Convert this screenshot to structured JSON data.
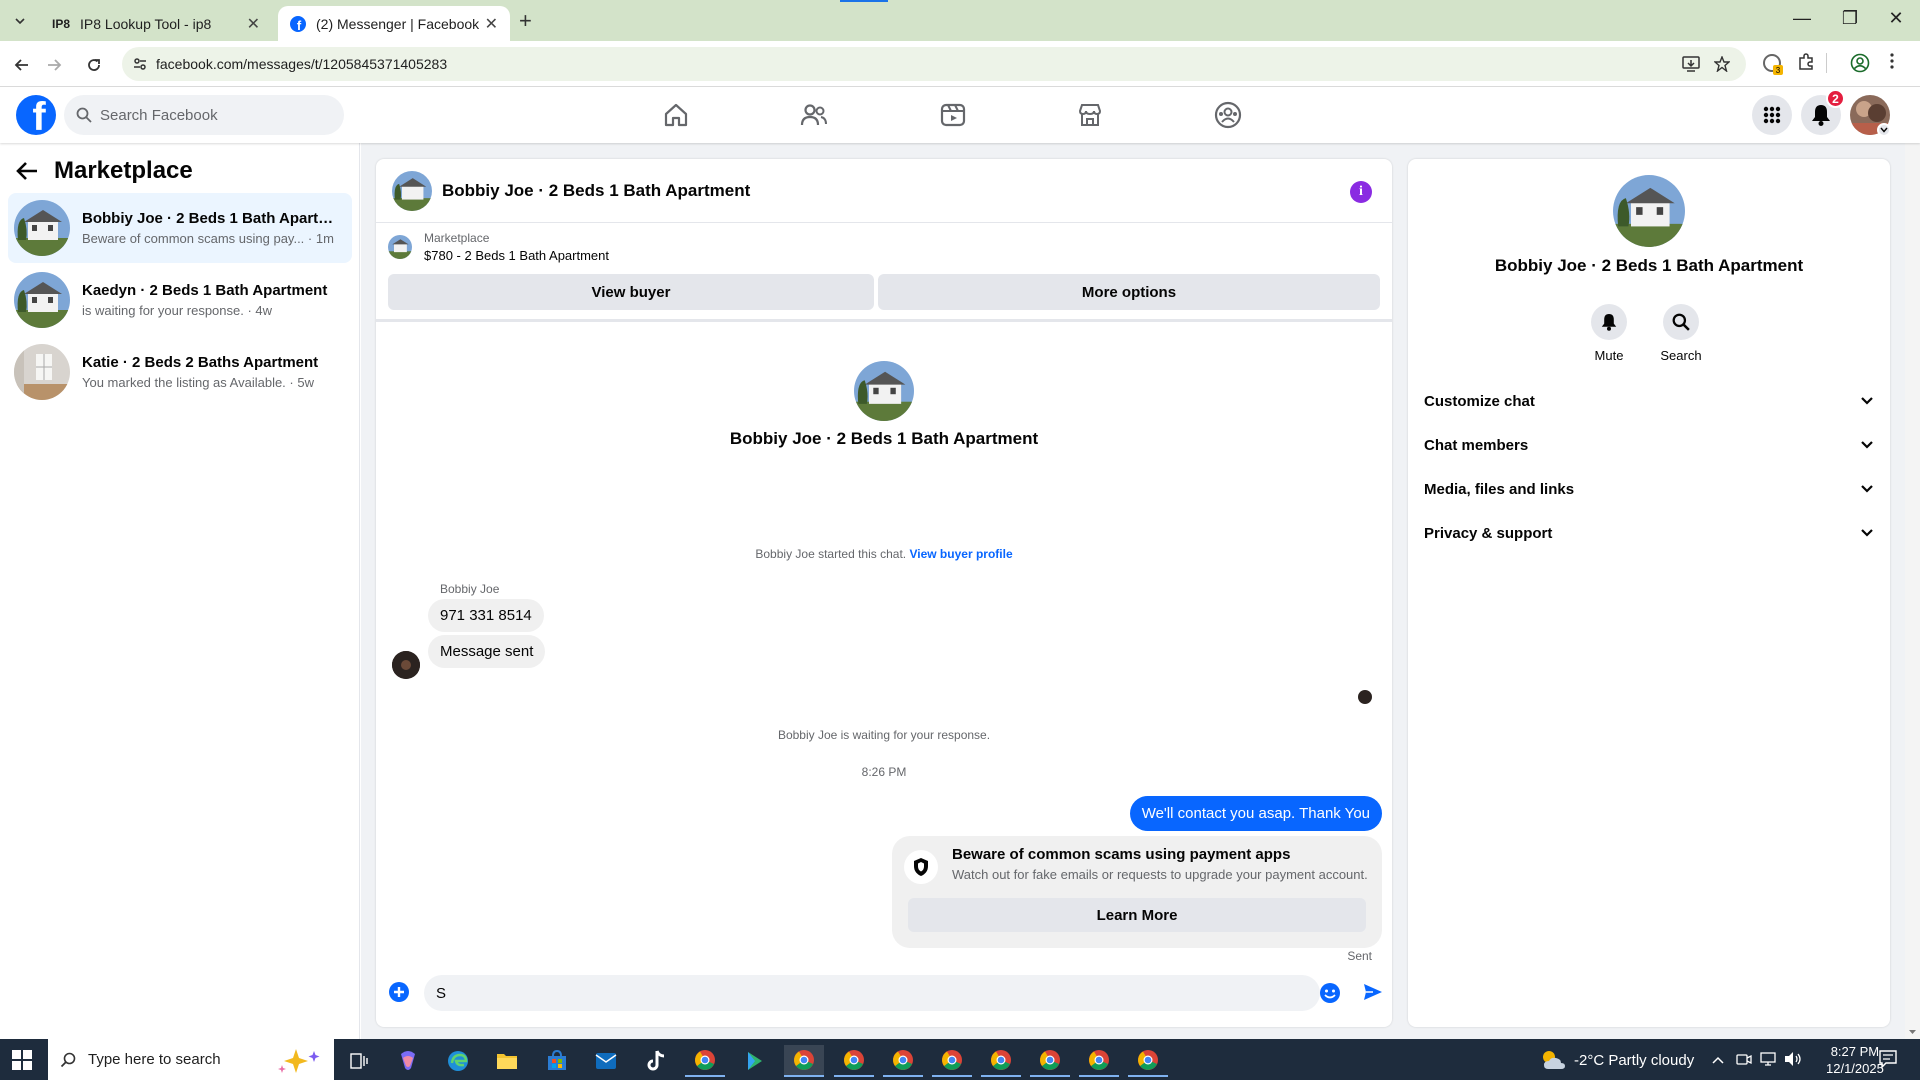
{
  "browser": {
    "tabs": [
      {
        "title": "IP8 Lookup Tool - ip8",
        "icon": "ip8-favicon",
        "active": false
      },
      {
        "title": "(2) Messenger | Facebook",
        "icon": "facebook-favicon",
        "active": true
      }
    ],
    "url": "facebook.com/messages/t/1205845371405283",
    "extension_badge": "3"
  },
  "fb_header": {
    "search_placeholder": "Search Facebook",
    "nav": [
      "home-icon",
      "friends-icon",
      "video-icon",
      "marketplace-icon",
      "groups-icon"
    ],
    "notification_count": "2",
    "brand_color": "#0866ff"
  },
  "sidebar": {
    "title": "Marketplace",
    "conversations": [
      {
        "name": "Bobbiy Joe · 2 Beds 1 Bath Apartm...",
        "preview": "Beware of common scams using pay... · 1m",
        "selected": true
      },
      {
        "name": "Kaedyn · 2 Beds 1 Bath Apartment",
        "preview": "is waiting for your response. · 4w",
        "selected": false
      },
      {
        "name": "Katie · 2 Beds 2 Baths Apartment",
        "preview": "You marked the listing as Available. · 5w",
        "selected": false
      }
    ]
  },
  "chat": {
    "title": "Bobbiy Joe · 2 Beds 1 Bath Apartment",
    "listing_source": "Marketplace",
    "listing_desc": "$780 - 2 Beds 1 Bath Apartment",
    "view_buyer_label": "View buyer",
    "more_options_label": "More options",
    "center_name": "Bobbiy Joe · 2 Beds 1 Bath Apartment",
    "started_text": "Bobbiy Joe started this chat.",
    "view_profile_label": "View buyer profile",
    "sender": "Bobbiy Joe",
    "incoming": [
      "971 331 8514",
      "Message sent"
    ],
    "waiting_text": "Bobbiy Joe is waiting for your response.",
    "timestamp": "8:26 PM",
    "outgoing": "We'll contact you asap. Thank You",
    "scam_title": "Beware of common scams using payment apps",
    "scam_body": "Watch out for fake emails or requests to upgrade your payment account.",
    "learn_more_label": "Learn More",
    "sent_label": "Sent",
    "composer_value": "S"
  },
  "details": {
    "name": "Bobbiy Joe · 2 Beds 1 Bath Apartment",
    "actions": [
      {
        "label": "Mute",
        "icon": "bell-icon"
      },
      {
        "label": "Search",
        "icon": "search-icon"
      }
    ],
    "sections": [
      "Customize chat",
      "Chat members",
      "Media, files and links",
      "Privacy & support"
    ]
  },
  "taskbar": {
    "search_placeholder": "Type here to search",
    "weather": "-2°C  Partly cloudy",
    "time": "8:27 PM",
    "date": "12/1/2025"
  }
}
